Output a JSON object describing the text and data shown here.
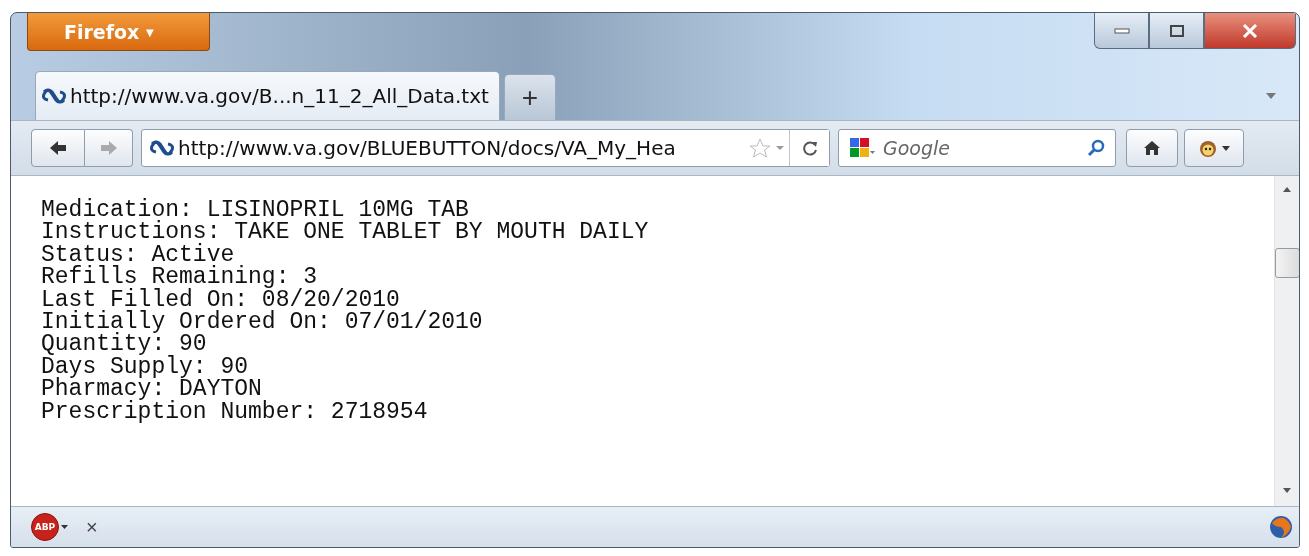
{
  "firefox_button": {
    "label": "Firefox",
    "caret": "▼"
  },
  "tabs": [
    {
      "title": "http://www.va.gov/B...n_11_2_All_Data.txt",
      "selected": true
    }
  ],
  "new_tab": "+",
  "address_bar": {
    "value": "http://www.va.gov/BLUEBUTTON/docs/VA_My_Hea"
  },
  "search": {
    "placeholder": "Google"
  },
  "content": {
    "lines": [
      "Medication: LISINOPRIL 10MG TAB",
      "Instructions: TAKE ONE TABLET BY MOUTH DAILY",
      "Status: Active",
      "Refills Remaining: 3",
      "Last Filled On: 08/20/2010",
      "Initially Ordered On: 07/01/2010",
      "Quantity: 90",
      "Days Supply: 90",
      "Pharmacy: DAYTON",
      "Prescription Number: 2718954"
    ]
  },
  "status_bar": {
    "addon_label": "ABP",
    "close": "×"
  }
}
